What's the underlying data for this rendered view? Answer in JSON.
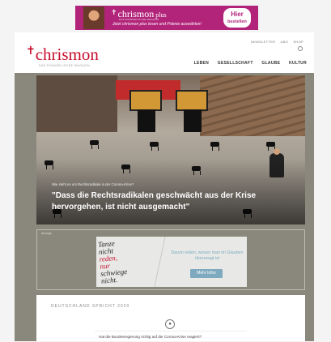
{
  "top_banner": {
    "brand": "chrismon",
    "brand_suffix": "plus",
    "cross": "✝",
    "tagline": "DAS EVANGELISCHE MAGAZIN",
    "subline": "Jetzt chrismon plus lesen und Prämie auswählen!",
    "button_line1": "Hier",
    "button_line2": "bestellen",
    "color": "#b1247a"
  },
  "header": {
    "logo": "chrismon",
    "logo_cross": "✝",
    "logo_tagline": "DAS EVANGELISCHE MAGAZIN",
    "utility_links": [
      "NEWSLETTER",
      "ABO",
      "SHOP"
    ],
    "search_icon": "search-icon",
    "nav": [
      "LEBEN",
      "GESELLSCHAFT",
      "GLAUBE",
      "KULTUR"
    ],
    "accent": "#c8102e"
  },
  "hero": {
    "kicker": "Wie steht es um Rechtsradikale in der Corona-Krise?",
    "title": "\"Dass die Rechtsradikalen geschwächt aus der Krise hervorgehen, ist nicht ausgemacht\""
  },
  "ad": {
    "label": "Anzeige",
    "callig_line1": "Tanze",
    "callig_line2": "nicht",
    "callig_line3": "reden,",
    "callig_line4": "nur",
    "callig_line5": "schwiege",
    "callig_line6": "nicht.",
    "text": "Davon reden, wovon man im Glauben überzeugt ist",
    "button": "Mehr Infos"
  },
  "survey": {
    "heading": "DEUTSCHLAND SPRICHT 2020",
    "icon": "chat-icon",
    "question": "Hat die Bundesregierung richtig auf die Corona-Krise reagiert?"
  }
}
